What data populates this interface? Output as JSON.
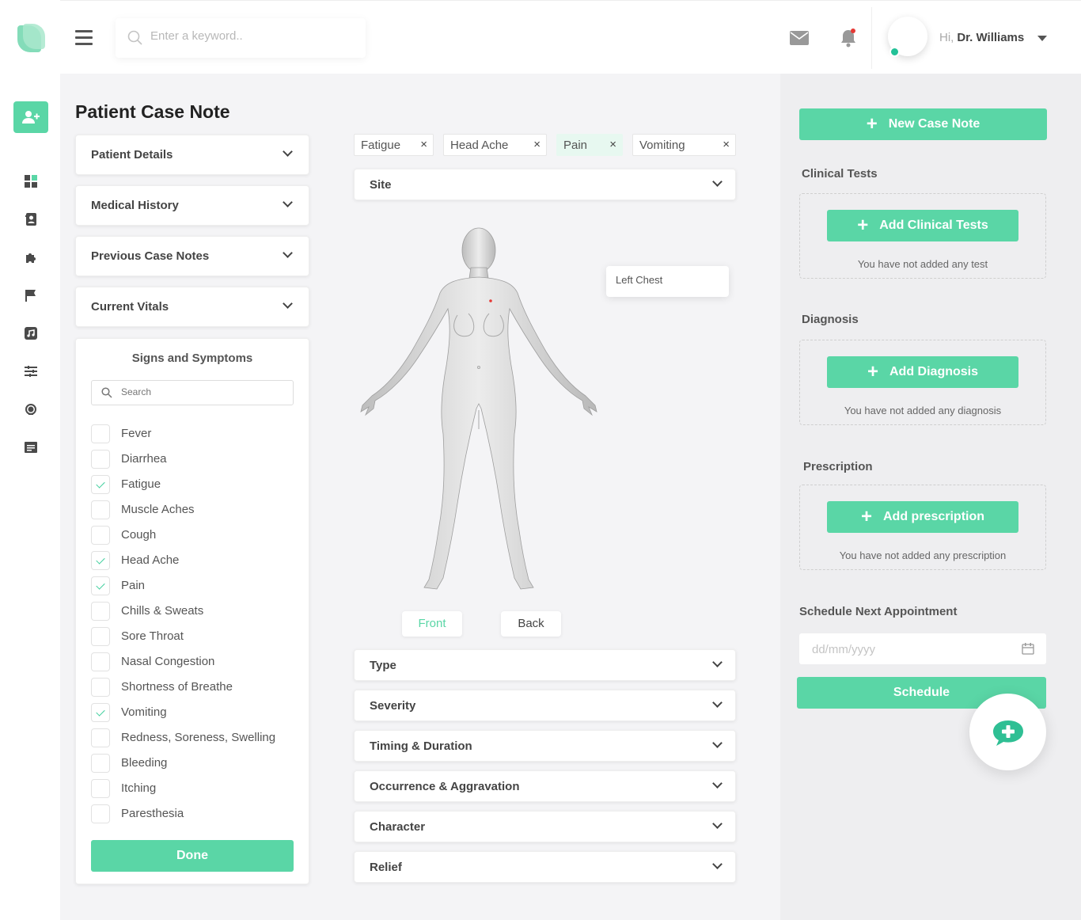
{
  "colors": {
    "accent": "#5ad6a6",
    "online": "#22c197",
    "notif": "#e53935"
  },
  "search": {
    "placeholder": "Enter a keyword.."
  },
  "user": {
    "hi": "Hi,",
    "name": "Dr. Williams"
  },
  "page": {
    "title": "Patient Case Note"
  },
  "left_sections": [
    "Patient Details",
    "Medical History",
    "Previous Case Notes",
    "Current Vitals"
  ],
  "signs": {
    "title": "Signs and Symptoms",
    "search_placeholder": "Search",
    "items": [
      {
        "label": "Fever",
        "checked": false
      },
      {
        "label": "Diarrhea",
        "checked": false
      },
      {
        "label": "Fatigue",
        "checked": true
      },
      {
        "label": "Muscle Aches",
        "checked": false
      },
      {
        "label": "Cough",
        "checked": false
      },
      {
        "label": "Head Ache",
        "checked": true
      },
      {
        "label": "Pain",
        "checked": true
      },
      {
        "label": "Chills & Sweats",
        "checked": false
      },
      {
        "label": "Sore Throat",
        "checked": false
      },
      {
        "label": "Nasal Congestion",
        "checked": false
      },
      {
        "label": "Shortness of Breathe",
        "checked": false
      },
      {
        "label": "Vomiting",
        "checked": true
      },
      {
        "label": "Redness, Soreness, Swelling",
        "checked": false
      },
      {
        "label": "Bleeding",
        "checked": false
      },
      {
        "label": "Itching",
        "checked": false
      },
      {
        "label": "Paresthesia",
        "checked": false
      }
    ],
    "done_label": "Done"
  },
  "tags": [
    {
      "label": "Fatigue",
      "active": false
    },
    {
      "label": "Head Ache",
      "active": false
    },
    {
      "label": "Pain",
      "active": true
    },
    {
      "label": "Vomiting",
      "active": false
    }
  ],
  "tag_close": "×",
  "site": {
    "label": "Site"
  },
  "tooltip": {
    "text": "Left Chest"
  },
  "views": {
    "front": "Front",
    "back": "Back",
    "active": "front"
  },
  "detail_sections": [
    "Type",
    "Severity",
    "Timing & Duration",
    "Occurrence & Aggravation",
    "Character",
    "Relief"
  ],
  "right": {
    "plus": "+",
    "new_case_note": "New Case Note",
    "clinical_tests": {
      "title": "Clinical Tests",
      "button": "Add Clinical Tests",
      "empty": "You have not added any test"
    },
    "diagnosis": {
      "title": "Diagnosis",
      "button": "Add Diagnosis",
      "empty": "You have not added any diagnosis"
    },
    "prescription": {
      "title": "Prescription",
      "button": "Add prescription",
      "empty": "You have not added any prescription"
    },
    "schedule": {
      "title": "Schedule Next Appointment",
      "placeholder": "dd/mm/yyyy",
      "button": "Schedule"
    }
  }
}
